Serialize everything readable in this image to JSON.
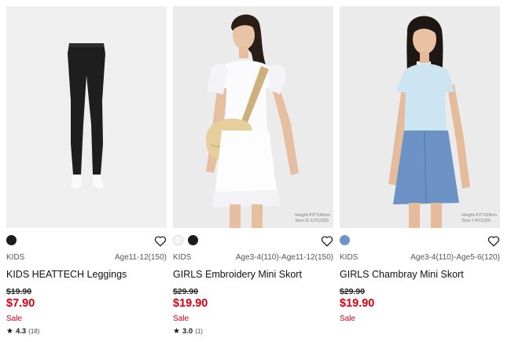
{
  "products": [
    {
      "category": "KIDS",
      "age_range": "Age11-12(150)",
      "name": "KIDS HEATTECH Leggings",
      "original_price": "$19.90",
      "sale_price": "$7.90",
      "sale_label": "Sale",
      "rating": "4.3",
      "review_count": "(18)",
      "swatches": [
        "#1c1c1c"
      ],
      "image_caption": ""
    },
    {
      "category": "KIDS",
      "age_range": "Age3-4(110)-Age11-12(150)",
      "name": "GIRLS Embroidery Mini Skort",
      "original_price": "$29.90",
      "sale_price": "$19.90",
      "sale_label": "Sale",
      "rating": "3.0",
      "review_count": "(1)",
      "swatches": [
        "#f7f7f7",
        "#1c1c1c"
      ],
      "image_caption": "Height:4'9\"/145cm\nSize:11-12Y(150)"
    },
    {
      "category": "KIDS",
      "age_range": "Age3-4(110)-Age5-6(120)",
      "name": "GIRLS Chambray Mini Skort",
      "original_price": "$29.90",
      "sale_price": "$19.90",
      "sale_label": "Sale",
      "rating": "",
      "review_count": "",
      "swatches": [
        "#6f93c4"
      ],
      "image_caption": "Height:4'2\"/128cm\nSize:7-8Y(130)"
    }
  ],
  "icons": {
    "favorite": "heart-outline-icon",
    "rating": "star-icon"
  },
  "colors": {
    "sale_red": "#d90012",
    "text": "#1b1b1b",
    "image_bg": "#eaeaea"
  }
}
